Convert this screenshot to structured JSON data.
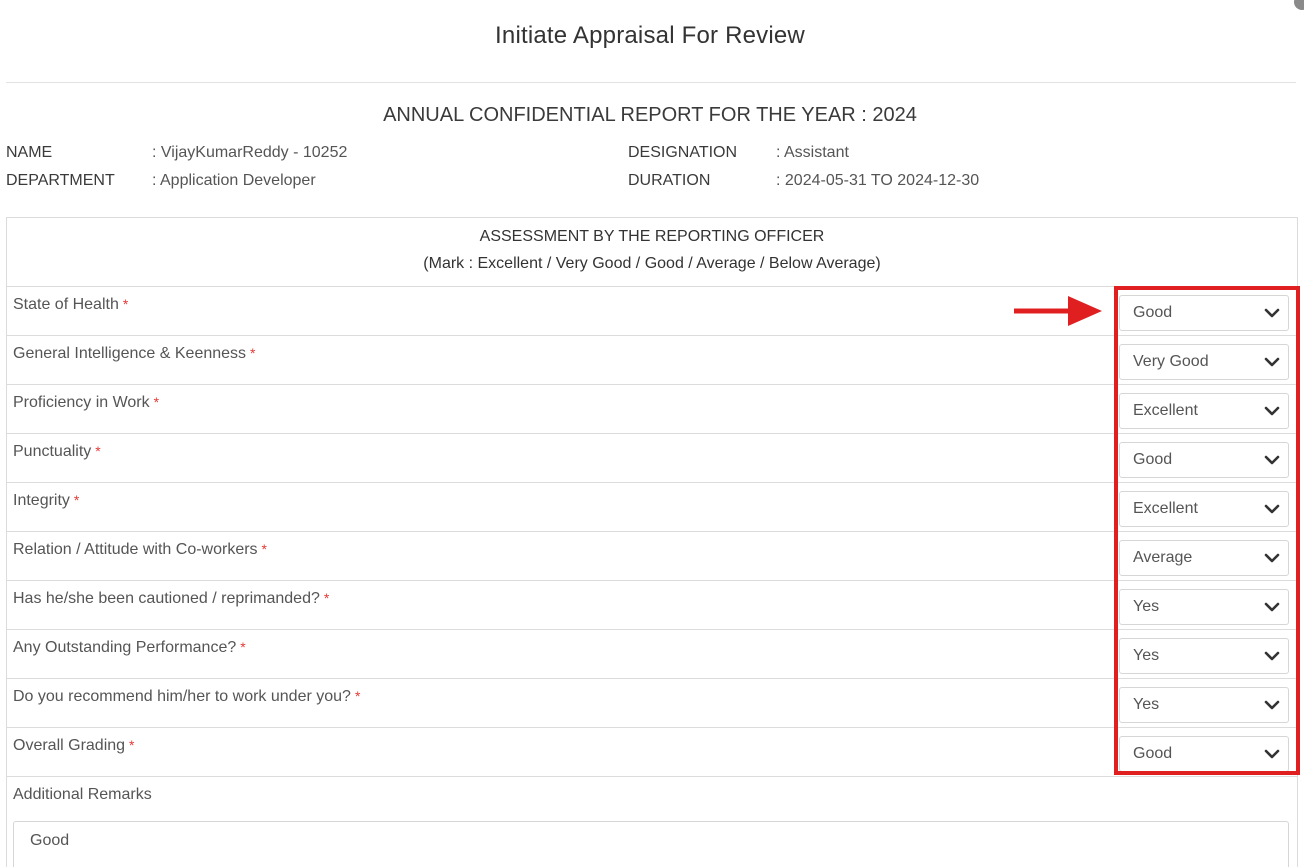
{
  "modal": {
    "title": "Initiate Appraisal For Review"
  },
  "report": {
    "heading": "ANNUAL CONFIDENTIAL REPORT FOR THE YEAR : 2024",
    "name_label": "NAME",
    "name_value": ": VijayKumarReddy - 10252",
    "department_label": "DEPARTMENT",
    "department_value": ": Application Developer",
    "designation_label": "DESIGNATION",
    "designation_value": ": Assistant",
    "duration_label": "DURATION",
    "duration_value": ": 2024-05-31 TO 2024-12-30"
  },
  "assessment": {
    "heading": "ASSESSMENT BY THE REPORTING OFFICER",
    "subheading": "(Mark : Excellent / Very Good / Good / Average / Below Average)",
    "required_marker": "*",
    "rows": [
      {
        "label": "State of Health",
        "value": "Good"
      },
      {
        "label": "General Intelligence & Keenness",
        "value": "Very Good"
      },
      {
        "label": "Proficiency in Work",
        "value": "Excellent"
      },
      {
        "label": "Punctuality",
        "value": "Good"
      },
      {
        "label": "Integrity",
        "value": "Excellent"
      },
      {
        "label": "Relation / Attitude with Co-workers",
        "value": "Average"
      },
      {
        "label": "Has he/she been cautioned / reprimanded?",
        "value": "Yes"
      },
      {
        "label": "Any Outstanding Performance?",
        "value": "Yes"
      },
      {
        "label": "Do you recommend him/her to work under you?",
        "value": "Yes"
      },
      {
        "label": "Overall Grading",
        "value": "Good"
      }
    ],
    "remarks_label": "Additional Remarks",
    "remarks_value": "Good"
  },
  "colors": {
    "highlight": "#e02020",
    "required": "#e53935",
    "border": "#dcdcdc"
  },
  "icons": {
    "select_arrow": "chevron-down-icon",
    "annotation": "red-arrow-icon"
  }
}
